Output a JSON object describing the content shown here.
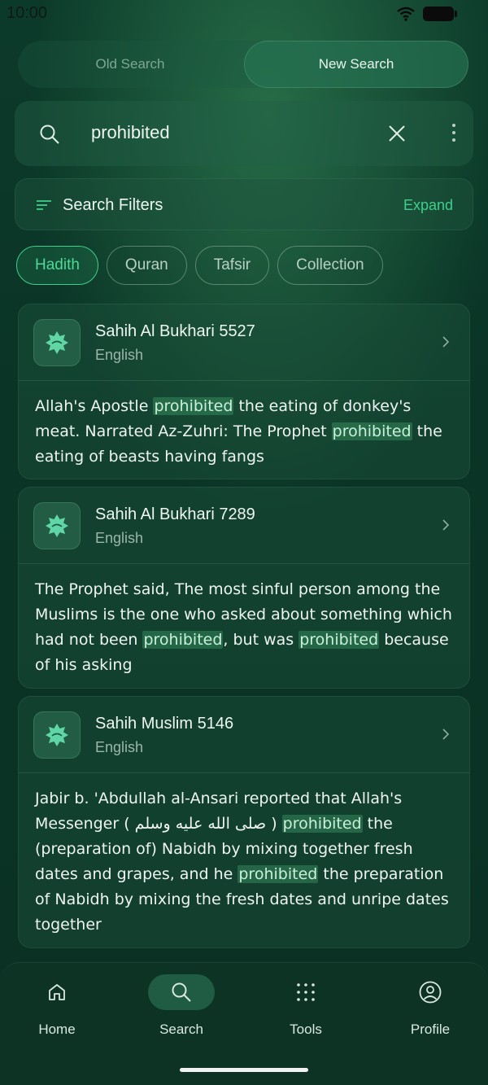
{
  "status": {
    "time": "10:00"
  },
  "tabs": {
    "old": "Old Search",
    "new": "New Search"
  },
  "search": {
    "query": "prohibited"
  },
  "filters": {
    "title": "Search Filters",
    "expand": "Expand"
  },
  "chips": [
    "Hadith",
    "Quran",
    "Tafsir",
    "Collection"
  ],
  "results": [
    {
      "title": "Sahih Al Bukhari 5527",
      "lang": "English",
      "text": [
        {
          "t": "Allah's Apostle "
        },
        {
          "t": "prohibited",
          "h": true
        },
        {
          "t": " the eating of donkey's meat. Narrated Az-Zuhri: The Prophet "
        },
        {
          "t": "prohibited",
          "h": true
        },
        {
          "t": " the eating of beasts having fangs"
        }
      ]
    },
    {
      "title": "Sahih Al Bukhari 7289",
      "lang": "English",
      "text": [
        {
          "t": "The Prophet said, The most sinful person among the Muslims is the one who asked about something which had not been "
        },
        {
          "t": "prohibited",
          "h": true
        },
        {
          "t": ", but was "
        },
        {
          "t": "prohibited",
          "h": true
        },
        {
          "t": " because of his asking"
        }
      ]
    },
    {
      "title": "Sahih Muslim 5146",
      "lang": "English",
      "text": [
        {
          "t": "Jabir b. 'Abdullah al-Ansari reported that Allah's Messenger ( صلى الله عليه وسلم ) "
        },
        {
          "t": "prohibited",
          "h": true
        },
        {
          "t": " the (preparation of) Nabidh by mixing together fresh dates and grapes, and he "
        },
        {
          "t": "prohibited",
          "h": true
        },
        {
          "t": " the preparation of Nabidh by mixing the fresh dates and unripe dates together"
        }
      ]
    }
  ],
  "nav": {
    "home": "Home",
    "search": "Search",
    "tools": "Tools",
    "profile": "Profile"
  },
  "colors": {
    "accent": "#3fcf8a",
    "background": "#0a3426"
  }
}
